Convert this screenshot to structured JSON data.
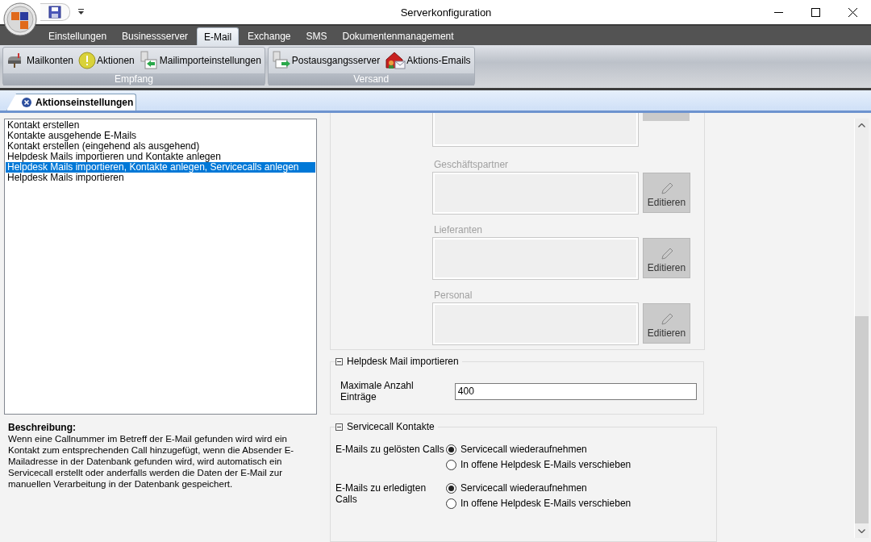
{
  "window": {
    "title": "Serverkonfiguration"
  },
  "ribbon": {
    "tabs": [
      {
        "label": "Einstellungen",
        "selected": false
      },
      {
        "label": "Businessserver",
        "selected": false
      },
      {
        "label": "E-Mail",
        "selected": true
      },
      {
        "label": "Exchange",
        "selected": false
      },
      {
        "label": "SMS",
        "selected": false
      },
      {
        "label": "Dokumentenmanagement",
        "selected": false
      }
    ],
    "groups": [
      {
        "label": "Empfang",
        "buttons": [
          {
            "label": "Mailkonten",
            "kind": "mailbox"
          },
          {
            "label": "Aktionen",
            "kind": "warning"
          },
          {
            "label": "Mailimporteinstellungen",
            "kind": "import"
          }
        ]
      },
      {
        "label": "Versand",
        "buttons": [
          {
            "label": "Postausgangsserver",
            "kind": "export"
          },
          {
            "label": "Aktions-Emails",
            "kind": "house"
          }
        ]
      }
    ]
  },
  "document_tabs": [
    {
      "label": "Aktionseinstellungen",
      "selected": true
    }
  ],
  "actions_list": {
    "items": [
      {
        "label": "Kontakt erstellen",
        "selected": false
      },
      {
        "label": "Kontakte ausgehende E-Mails",
        "selected": false
      },
      {
        "label": "Kontakt erstellen (eingehend als ausgehend)",
        "selected": false
      },
      {
        "label": "Helpdesk Mails importieren und Kontakte anlegen",
        "selected": false
      },
      {
        "label": "Helpdesk Mails importieren, Kontakte anlegen, Servicecalls anlegen",
        "selected": true
      },
      {
        "label": "Helpdesk Mails importieren",
        "selected": false
      }
    ]
  },
  "description": {
    "heading": "Beschreibung:",
    "text": "Wenn eine Callnummer im Betreff der E-Mail gefunden wird wird ein Kontakt zum entsprechenden Call hinzugefügt, wenn die Absender E-Mailadresse in der Datenbank gefunden wird, wird automatisch ein Servicecall erstellt oder anderfalls werden die Daten der E-Mail zur manuellen Verarbeitung in der Datenbank gespeichert."
  },
  "recipient_fields": [
    {
      "label": "Geschäftspartner",
      "button": "Editieren"
    },
    {
      "label": "Lieferanten",
      "button": "Editieren"
    },
    {
      "label": "Personal",
      "button": "Editieren"
    }
  ],
  "helpdesk_import": {
    "title": "Helpdesk Mail importieren",
    "expanded": true,
    "fields": [
      {
        "label": "Maximale Anzahl Einträge",
        "value": "400"
      }
    ]
  },
  "servicecall_contacts": {
    "title": "Servicecall Kontakte",
    "expanded": true,
    "groups": [
      {
        "label": "E-Mails zu gelösten Calls",
        "options": [
          {
            "label": "Servicecall wiederaufnehmen",
            "selected": true
          },
          {
            "label": "In offene Helpdesk E-Mails verschieben",
            "selected": false
          }
        ]
      },
      {
        "label": "E-Mails zu erledigten Calls",
        "options": [
          {
            "label": "Servicecall wiederaufnehmen",
            "selected": true
          },
          {
            "label": "In offene Helpdesk E-Mails verschieben",
            "selected": false
          }
        ]
      }
    ]
  }
}
